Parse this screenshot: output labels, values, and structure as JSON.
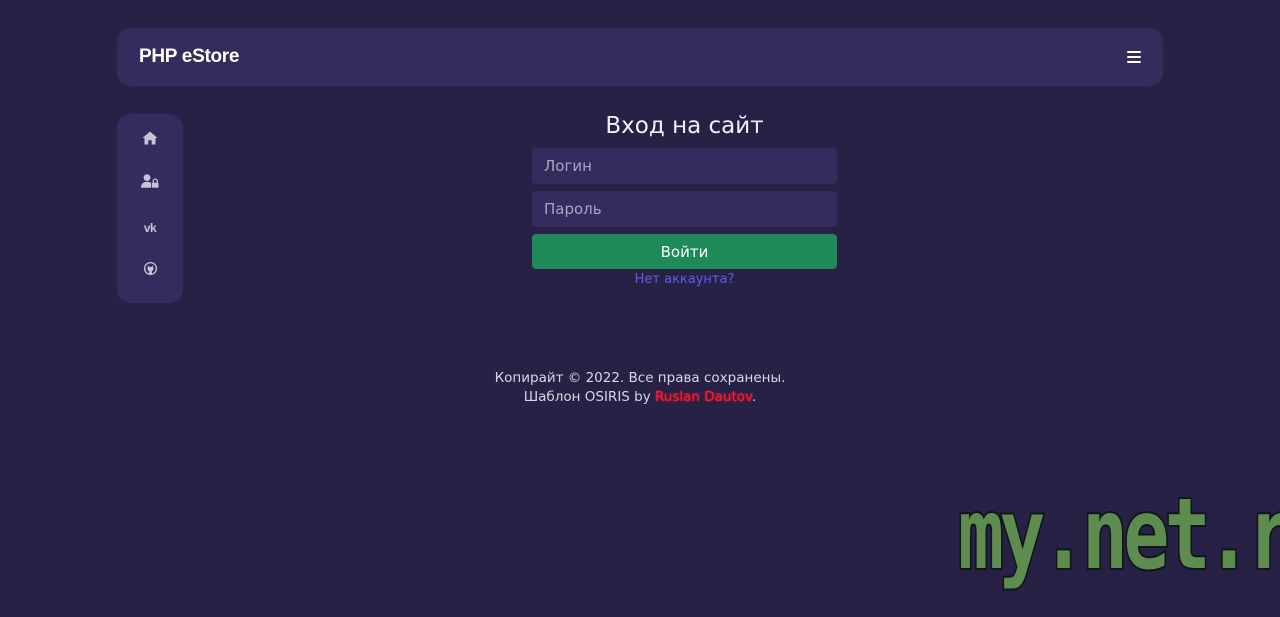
{
  "navbar": {
    "brand": "PHP eStore",
    "menu_icon": "hamburger-icon"
  },
  "sidebar": {
    "items": [
      {
        "icon": "home-icon"
      },
      {
        "icon": "user-lock-icon"
      },
      {
        "icon": "vk-icon",
        "text": "vk"
      },
      {
        "icon": "github-icon"
      }
    ]
  },
  "login": {
    "title": "Вход на сайт",
    "login_placeholder": "Логин",
    "password_placeholder": "Пароль",
    "submit_label": "Войти",
    "signup_link": "Нет аккаунта?"
  },
  "footer": {
    "line1": "Копирайт © 2022. Все права сохранены.",
    "line2_prefix": "Шаблон OSIRIS by",
    "author": "Ruslan Dautov",
    "line2_suffix": "."
  },
  "watermark": "my.net.ru",
  "colors": {
    "background": "#272146",
    "panel": "#352c5d",
    "submit": "#1d8a57",
    "link": "#5d5fe8",
    "author": "#ff1b2d",
    "watermark": "#5d8c4e"
  }
}
